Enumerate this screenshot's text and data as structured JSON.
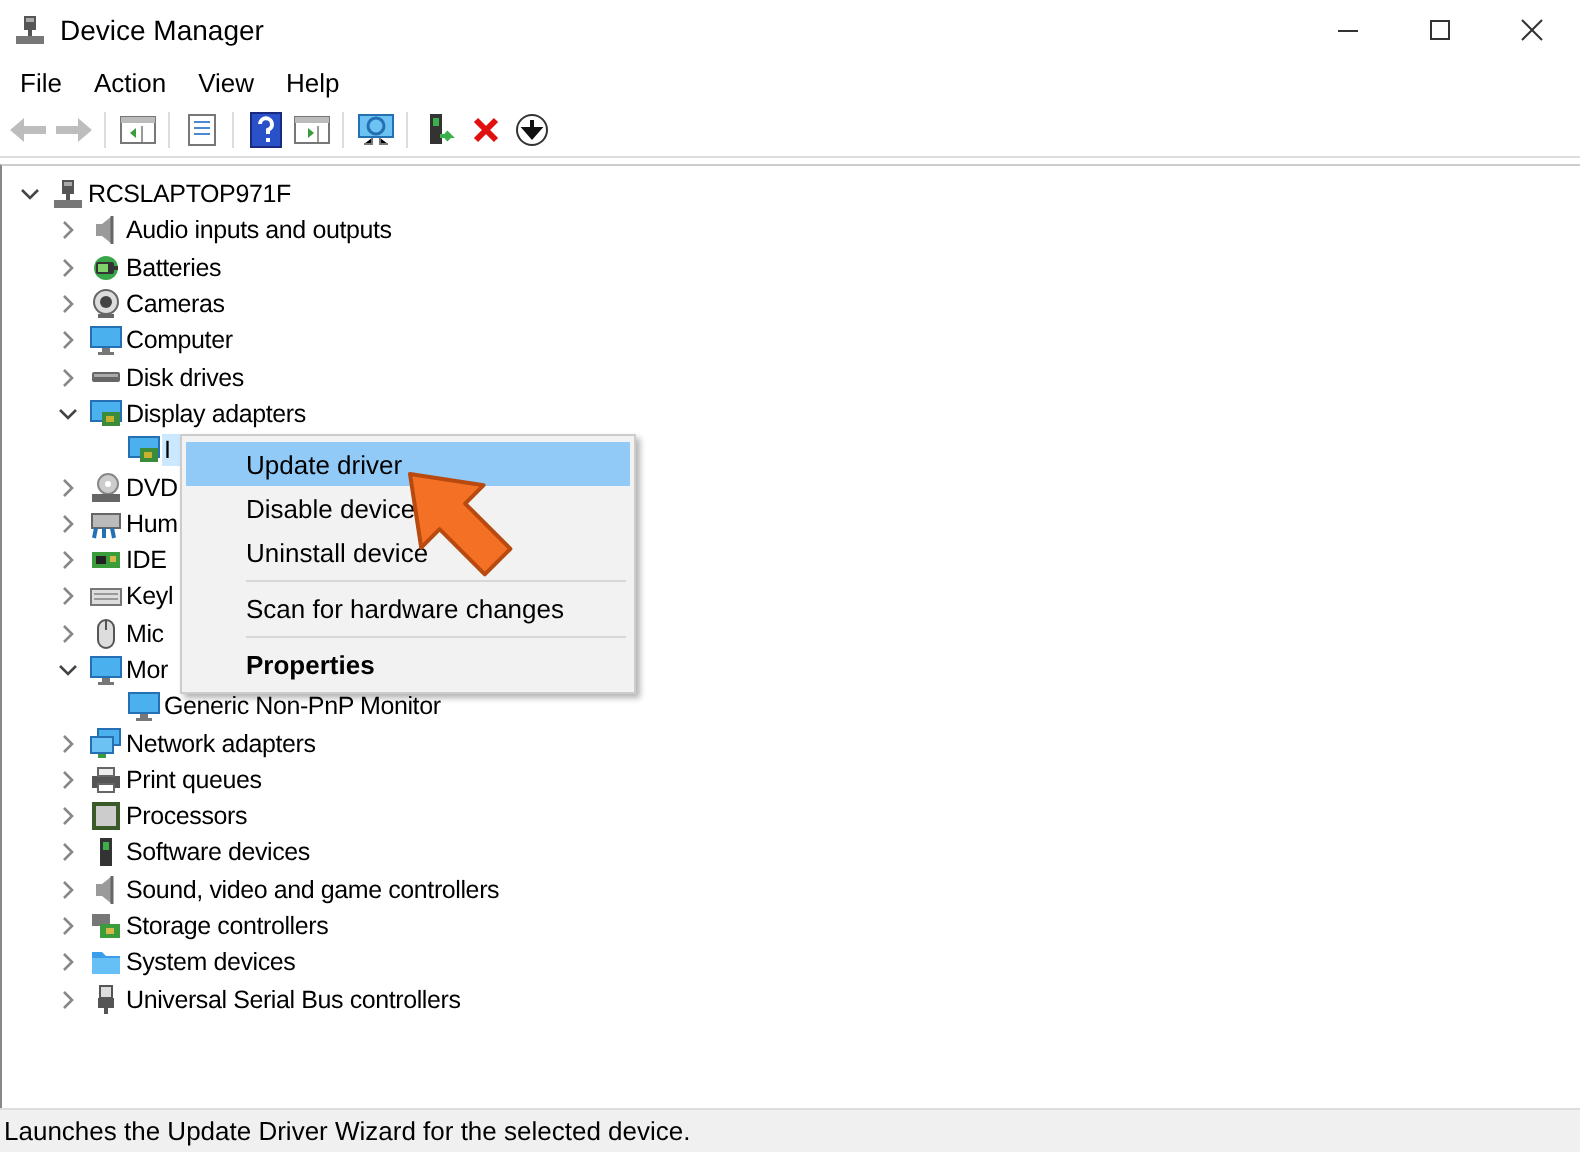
{
  "window": {
    "title": "Device Manager"
  },
  "menu_bar": [
    "File",
    "Action",
    "View",
    "Help"
  ],
  "toolbar": [
    {
      "kind": "back",
      "disabled": true
    },
    {
      "kind": "forward",
      "disabled": true
    },
    {
      "kind": "separator"
    },
    {
      "kind": "console-tree",
      "disabled": false
    },
    {
      "kind": "separator"
    },
    {
      "kind": "properties",
      "disabled": false
    },
    {
      "kind": "separator"
    },
    {
      "kind": "help",
      "disabled": false
    },
    {
      "kind": "action-pane",
      "disabled": false
    },
    {
      "kind": "separator"
    },
    {
      "kind": "scan",
      "disabled": false
    },
    {
      "kind": "separator"
    },
    {
      "kind": "add-driver",
      "disabled": false
    },
    {
      "kind": "uninstall",
      "disabled": false
    },
    {
      "kind": "download",
      "disabled": false
    }
  ],
  "tree": {
    "root": {
      "label": "RCSLAPTOP971F",
      "kind": "computer-root",
      "expanded": true,
      "selected": false,
      "children": [
        {
          "label": "Audio inputs and outputs",
          "kind": "speaker",
          "expanded": false,
          "selected": false
        },
        {
          "label": "Batteries",
          "kind": "battery",
          "expanded": false,
          "selected": false
        },
        {
          "label": "Cameras",
          "kind": "camera",
          "expanded": false,
          "selected": false
        },
        {
          "label": "Computer",
          "kind": "monitor",
          "expanded": false,
          "selected": false
        },
        {
          "label": "Disk drives",
          "kind": "disk",
          "expanded": false,
          "selected": false
        },
        {
          "label": "Display adapters",
          "kind": "display-adapter",
          "expanded": true,
          "selected": false,
          "children": [
            {
              "label": "I",
              "kind": "display-adapter",
              "selected": true
            }
          ]
        },
        {
          "label": "DVD",
          "kind": "dvd",
          "expanded": false,
          "selected": false
        },
        {
          "label": "Hum",
          "kind": "hid",
          "expanded": false,
          "selected": false
        },
        {
          "label": "IDE",
          "kind": "ide",
          "expanded": false,
          "selected": false
        },
        {
          "label": "Keyl",
          "kind": "keyboard",
          "expanded": false,
          "selected": false
        },
        {
          "label": "Mic",
          "kind": "mouse",
          "expanded": false,
          "selected": false
        },
        {
          "label": "Mor",
          "kind": "monitor",
          "expanded": true,
          "selected": false,
          "children": [
            {
              "label": "Generic Non-PnP Monitor",
              "kind": "monitor",
              "selected": false
            }
          ]
        },
        {
          "label": "Network adapters",
          "kind": "network",
          "expanded": false,
          "selected": false
        },
        {
          "label": "Print queues",
          "kind": "printer",
          "expanded": false,
          "selected": false
        },
        {
          "label": "Processors",
          "kind": "processor",
          "expanded": false,
          "selected": false
        },
        {
          "label": "Software devices",
          "kind": "software",
          "expanded": false,
          "selected": false
        },
        {
          "label": "Sound, video and game controllers",
          "kind": "speaker",
          "expanded": false,
          "selected": false
        },
        {
          "label": "Storage controllers",
          "kind": "storage",
          "expanded": false,
          "selected": false
        },
        {
          "label": "System devices",
          "kind": "folder",
          "expanded": false,
          "selected": false
        },
        {
          "label": "Universal Serial Bus controllers",
          "kind": "usb",
          "expanded": false,
          "selected": false
        }
      ]
    }
  },
  "context_menu": {
    "items": [
      {
        "kind": "item",
        "label": "Update driver",
        "selected": true,
        "default": false
      },
      {
        "kind": "item",
        "label": "Disable device",
        "selected": false,
        "default": false
      },
      {
        "kind": "item",
        "label": "Uninstall device",
        "selected": false,
        "default": false
      },
      {
        "kind": "separator"
      },
      {
        "kind": "item",
        "label": "Scan for hardware changes",
        "selected": false,
        "default": false
      },
      {
        "kind": "separator"
      },
      {
        "kind": "item",
        "label": "Properties",
        "selected": false,
        "default": true
      }
    ]
  },
  "status_bar": {
    "text": "Launches the Update Driver Wizard for the selected device."
  }
}
